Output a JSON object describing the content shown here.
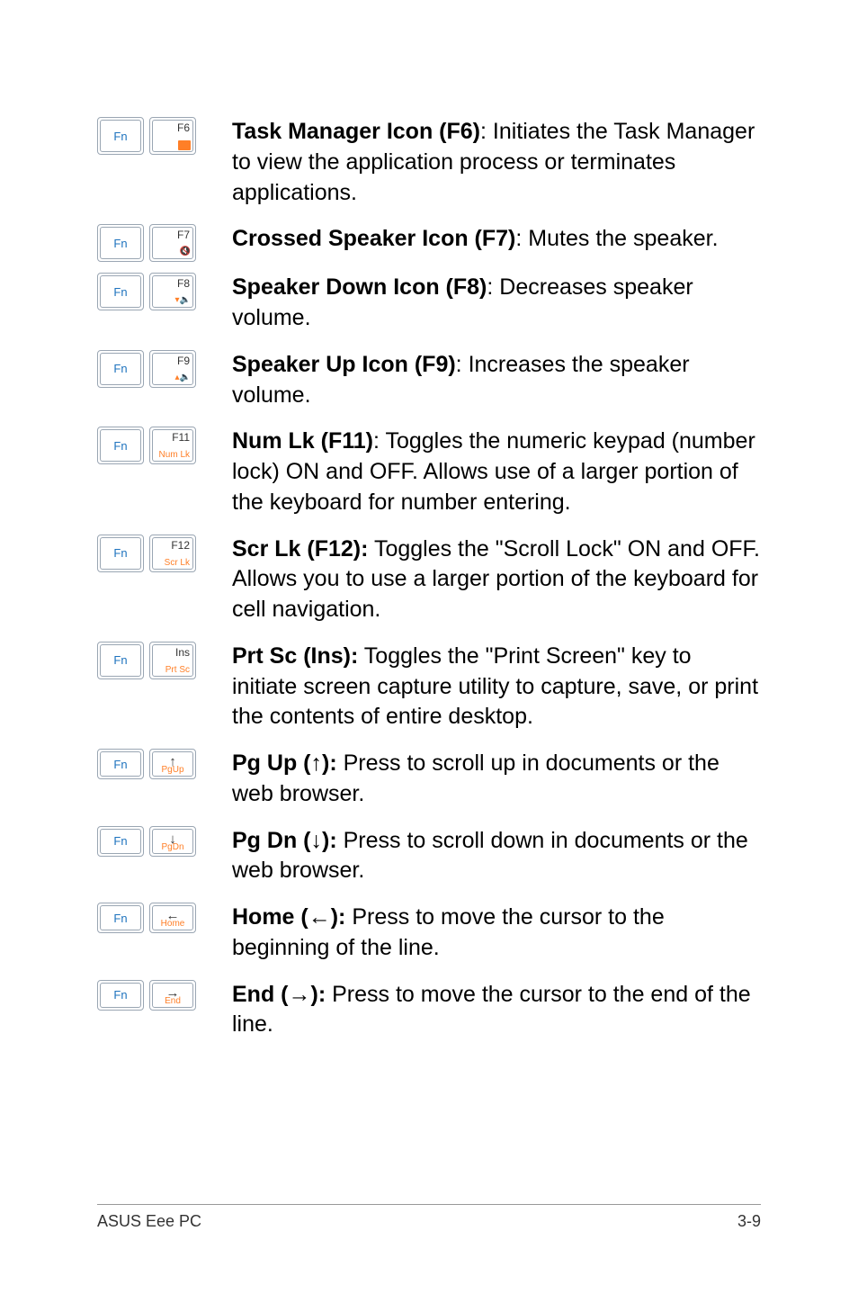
{
  "keys": {
    "fn": "Fn",
    "f6": "F6",
    "f7": "F7",
    "f8": "F8",
    "f9": "F9",
    "f11": "F11",
    "f11_sub": "Num Lk",
    "f12": "F12",
    "f12_sub": "Scr Lk",
    "ins": "Ins",
    "ins_sub": "Prt Sc",
    "up": "↑",
    "up_sub": "PgUp",
    "down": "↓",
    "down_sub": "PgDn",
    "left": "←",
    "left_sub": "Home",
    "right": "→",
    "right_sub": "End"
  },
  "icons": {
    "f7_sub": "🔇",
    "f8_sub": "▾🔈",
    "f9_sub": "▴🔈"
  },
  "items": {
    "f6": {
      "b": "Task Manager Icon (F6)",
      "sep": ": ",
      "t": "Initiates the Task Manager to view the application process or terminates applications."
    },
    "f7": {
      "b": "Crossed Speaker Icon (F7)",
      "sep": ": ",
      "t": "Mutes the speaker."
    },
    "f8": {
      "b": "Speaker Down Icon (F8)",
      "sep": ": ",
      "t": "Decreases speaker volume."
    },
    "f9": {
      "b": "Speaker Up Icon (F9)",
      "sep": ": ",
      "t": "Increases the speaker volume."
    },
    "f11": {
      "b": "Num Lk (F11)",
      "sep": ": ",
      "t": "Toggles the numeric keypad (number lock) ON and OFF. Allows use of a larger portion of the keyboard for number entering."
    },
    "f12": {
      "b": "Scr Lk (F12):",
      "sep": " ",
      "t": "Toggles the \"Scroll Lock\" ON and OFF. Allows you to use a larger portion of the keyboard for cell navigation."
    },
    "ins": {
      "b": "Prt Sc (Ins):",
      "sep": " ",
      "t": "Toggles the \"Print Screen\" key to initiate screen capture utility to capture, save, or print the contents of entire desktop."
    },
    "pgup": {
      "b": "Pg Up (↑):",
      "sep": " ",
      "t": "Press to scroll up in documents or the web browser."
    },
    "pgdn": {
      "b": "Pg Dn (↓):",
      "sep": " ",
      "t": "Press to scroll down in documents or the web browser."
    },
    "home": {
      "b": "Home (←):",
      "sep": " ",
      "t": "Press to move the cursor to the beginning of the line."
    },
    "end": {
      "b": "End (→):",
      "sep": " ",
      "t": "Press to move the cursor to the end of the line."
    }
  },
  "footer": {
    "left": "ASUS Eee PC",
    "right": "3-9"
  }
}
